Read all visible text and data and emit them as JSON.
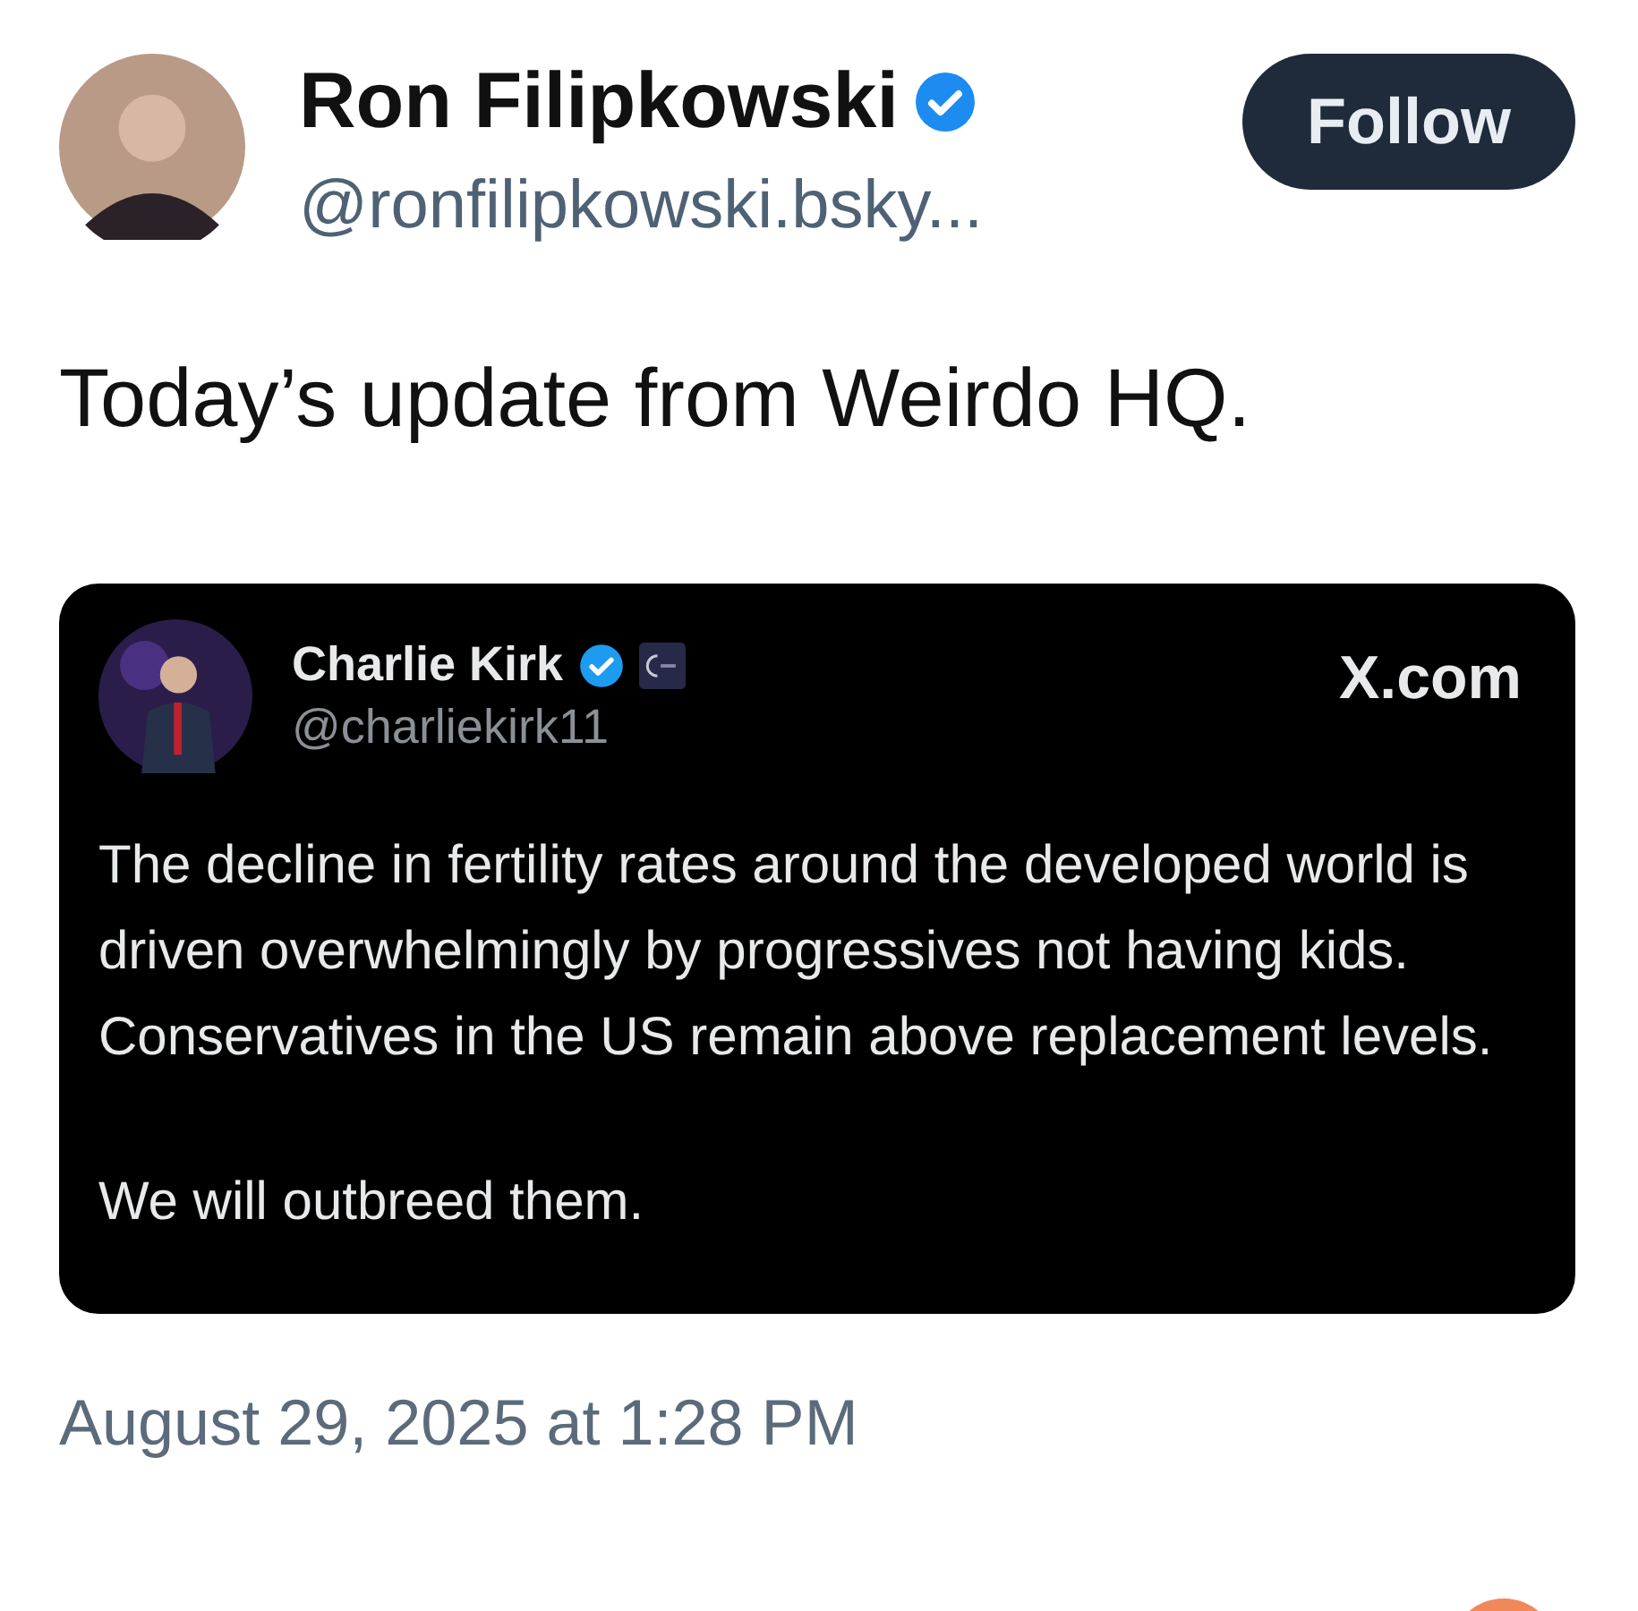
{
  "author": {
    "name": "Ron Filipkowski",
    "verified": true,
    "handle": "@ronfilipkowski.bsky..."
  },
  "follow_button": {
    "label": "Follow"
  },
  "post_text": "Today’s update from Weirdo HQ.",
  "quoted_post": {
    "author": {
      "name": "Charlie Kirk",
      "verified": true,
      "affiliate_badge": true,
      "handle": "@charliekirk11"
    },
    "source": "X.com",
    "paragraphs": [
      "The decline in fertility rates around the developed world is driven overwhelmingly by progressives not having kids. Conservatives in the US remain above replacement levels.",
      "We will outbreed them."
    ]
  },
  "timestamp": "August 29, 2025 at 1:28 PM"
}
